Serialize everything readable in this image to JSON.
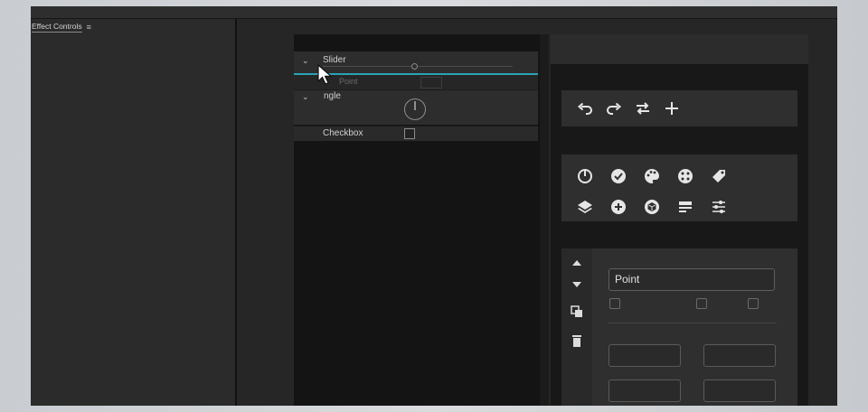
{
  "panel": {
    "title": "Effect Controls",
    "menu_icon": "hamburger-icon"
  },
  "effects": {
    "rows": [
      {
        "label": "Slider",
        "expanded": true
      },
      {
        "label": "Point"
      },
      {
        "label": "Angle",
        "visible_text": "ngle",
        "expanded": true
      },
      {
        "label": "Checkbox",
        "checked": false
      }
    ]
  },
  "toolbar": {
    "icons": [
      "undo-icon",
      "redo-icon",
      "swap-icon",
      "add-icon"
    ]
  },
  "icon_palette": {
    "icons": [
      "power-icon",
      "checkmark-circle-icon",
      "palette-icon",
      "dice-icon",
      "tag-icon",
      "layers-icon",
      "plus-circle-icon",
      "cube-icon",
      "list-icon",
      "sliders-icon"
    ]
  },
  "properties": {
    "side_icons": [
      "arrow-up-icon",
      "arrow-down-icon",
      "duplicate-icon",
      "trash-icon"
    ],
    "name_field_value": "Point"
  },
  "colors": {
    "accent": "#2aa3b6",
    "panel_bg": "#2b2b2b",
    "card_bg": "#2f2f2f"
  }
}
